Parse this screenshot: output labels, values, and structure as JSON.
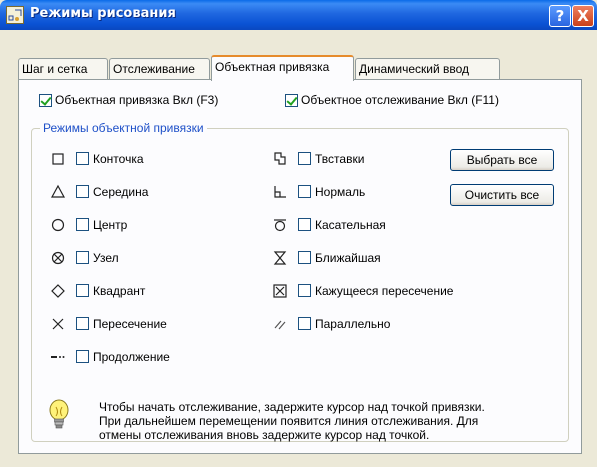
{
  "window": {
    "title": "Режимы рисования",
    "help_glyph": "?",
    "close_glyph": "X"
  },
  "tabs": [
    {
      "label": "Шаг и сетка",
      "active": false
    },
    {
      "label": "Отслеживание",
      "active": false
    },
    {
      "label": "Объектная привязка",
      "active": true
    },
    {
      "label": "Динамический ввод",
      "active": false
    }
  ],
  "toggles": {
    "osnap": {
      "label": "Объектная привязка Вкл (F3)",
      "checked": true
    },
    "otrack": {
      "label": "Объектное отслеживание Вкл (F11)",
      "checked": true
    }
  },
  "group_title": "Режимы объектной привязки",
  "modes_left": [
    {
      "label": "Конточка",
      "icon": "square-endpoint-icon",
      "checked": false
    },
    {
      "label": "Середина",
      "icon": "triangle-midpoint-icon",
      "checked": false
    },
    {
      "label": "Центр",
      "icon": "circle-center-icon",
      "checked": false
    },
    {
      "label": "Узел",
      "icon": "node-icon",
      "checked": false
    },
    {
      "label": "Квадрант",
      "icon": "diamond-quadrant-icon",
      "checked": false
    },
    {
      "label": "Пересечение",
      "icon": "x-intersection-icon",
      "checked": false
    },
    {
      "label": "Продолжение",
      "icon": "extension-icon",
      "checked": false
    }
  ],
  "modes_right": [
    {
      "label": "Твставки",
      "icon": "insertion-icon",
      "checked": false
    },
    {
      "label": "Нормаль",
      "icon": "perpendicular-icon",
      "checked": false
    },
    {
      "label": "Касательная",
      "icon": "tangent-icon",
      "checked": false
    },
    {
      "label": "Ближайшая",
      "icon": "hourglass-nearest-icon",
      "checked": false
    },
    {
      "label": "Кажущееся пересечение",
      "icon": "apparent-intersection-icon",
      "checked": false
    },
    {
      "label": "Параллельно",
      "icon": "parallel-icon",
      "checked": false
    }
  ],
  "buttons": {
    "select_all": "Выбрать все",
    "clear_all": "Очистить все"
  },
  "hint": {
    "icon": "lightbulb-icon",
    "lines": [
      "Чтобы начать отслеживание, задержите курсор над точкой привязки.",
      "При дальнейшем перемещении появится линия отслеживания. Для",
      "отмены отслеживания вновь задержите курсор над точкой."
    ]
  }
}
